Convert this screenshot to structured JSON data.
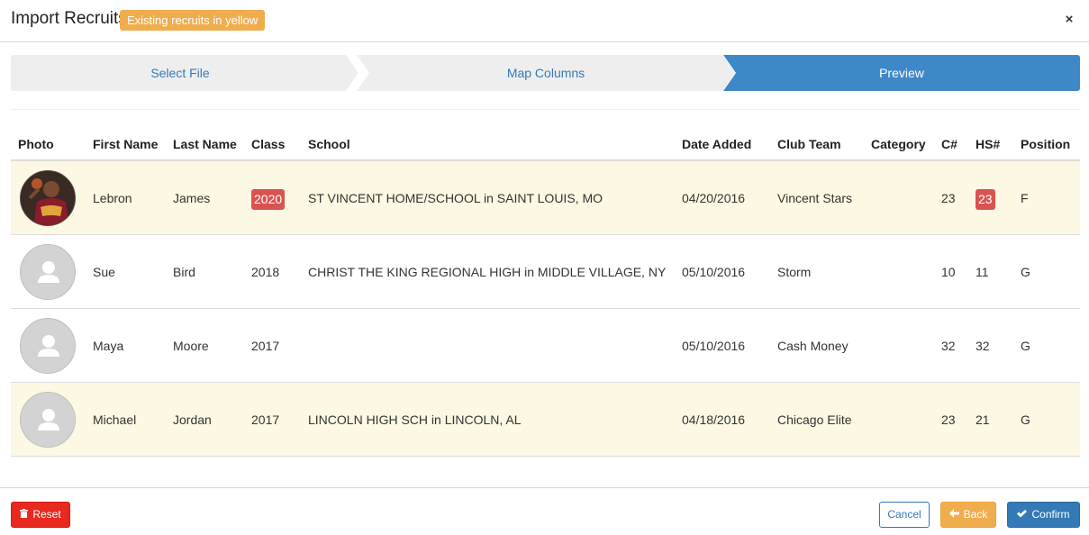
{
  "modal": {
    "title": "Import Recruits",
    "hint_badge": "Existing recruits in yellow",
    "close_glyph": "×"
  },
  "steps": [
    "Select File",
    "Map Columns",
    "Preview"
  ],
  "active_step": "Preview",
  "table": {
    "columns": [
      "Photo",
      "First Name",
      "Last Name",
      "Class",
      "School",
      "Date Added",
      "Club Team",
      "Category",
      "C#",
      "HS#",
      "Position"
    ],
    "rows": [
      {
        "existing": true,
        "photo": "player-photo",
        "first": "Lebron",
        "last": "James",
        "class": "2020",
        "class_flag": true,
        "school": "ST VINCENT HOME/SCHOOL in SAINT LOUIS, MO",
        "date": "04/20/2016",
        "club": "Vincent Stars",
        "category": "",
        "cnum": "23",
        "hsnum": "23",
        "hsnum_flag": true,
        "position": "F"
      },
      {
        "existing": false,
        "photo": "default-avatar",
        "first": "Sue",
        "last": "Bird",
        "class": "2018",
        "class_flag": false,
        "school": "CHRIST THE KING REGIONAL HIGH in MIDDLE VILLAGE, NY",
        "date": "05/10/2016",
        "club": "Storm",
        "category": "",
        "cnum": "10",
        "hsnum": "11",
        "hsnum_flag": false,
        "position": "G"
      },
      {
        "existing": false,
        "photo": "default-avatar",
        "first": "Maya",
        "last": "Moore",
        "class": "2017",
        "class_flag": false,
        "school": "",
        "date": "05/10/2016",
        "club": "Cash Money",
        "category": "",
        "cnum": "32",
        "hsnum": "32",
        "hsnum_flag": false,
        "position": "G"
      },
      {
        "existing": true,
        "photo": "default-avatar",
        "first": "Michael",
        "last": "Jordan",
        "class": "2017",
        "class_flag": false,
        "school": "LINCOLN HIGH SCH in LINCOLN, AL",
        "date": "04/18/2016",
        "club": "Chicago Elite",
        "category": "",
        "cnum": "23",
        "hsnum": "21",
        "hsnum_flag": false,
        "position": "G"
      }
    ]
  },
  "footer": {
    "reset_label": "Reset",
    "cancel_label": "Cancel",
    "back_label": "Back",
    "confirm_label": "Confirm"
  },
  "colors": {
    "existing_row": "#fcf8e3",
    "warning_badge": "#f0ad4e",
    "flag_red": "#d9534f",
    "active_step": "#3f88c8",
    "primary": "#337ab7",
    "danger": "#e8291f"
  },
  "icons": {
    "reset": "trash-icon",
    "back": "arrow-left-icon",
    "confirm": "check-icon",
    "close": "close-icon"
  }
}
